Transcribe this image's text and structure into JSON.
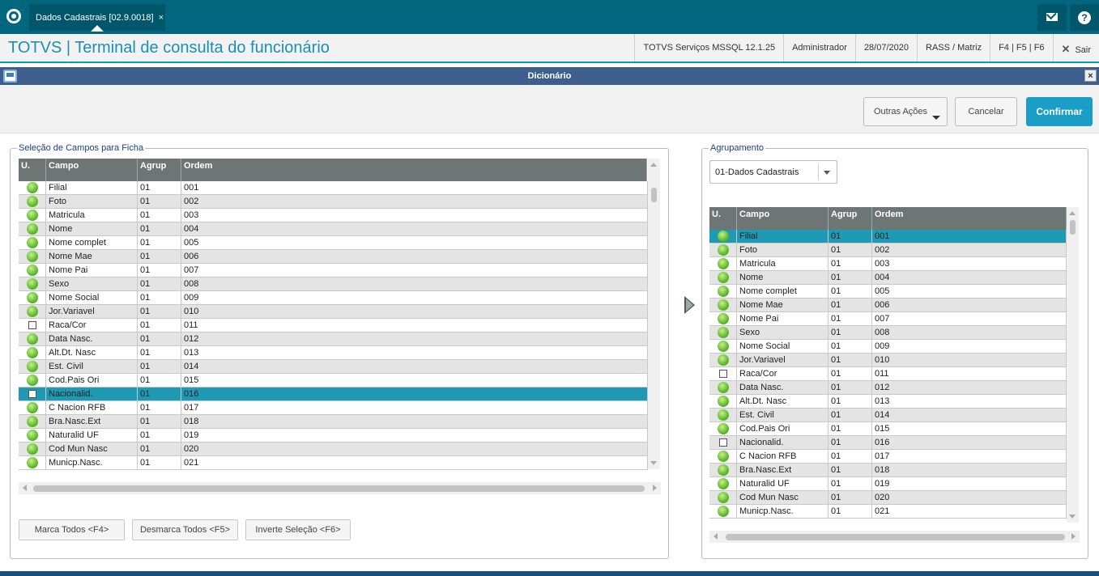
{
  "topbar": {
    "tab_label": "Dados Cadastrais [02.9.0018]",
    "tab_close": "×"
  },
  "header": {
    "title": "TOTVS | Terminal de consulta do funcionário",
    "server": "TOTVS Serviços MSSQL 12.1.25",
    "user": "Administrador",
    "date": "28/07/2020",
    "branch": "RASS / Matriz",
    "shortcuts": "F4 | F5 | F6",
    "exit_icon": "✕",
    "exit_label": "Sair"
  },
  "dialog": {
    "title": "Dicionário",
    "close": "×"
  },
  "actions": {
    "other": "Outras Ações",
    "cancel": "Cancelar",
    "confirm": "Confirmar"
  },
  "left_panel": {
    "legend": "Seleção de Campos para Ficha",
    "columns": [
      "U.",
      "Campo",
      "Agrup",
      "Ordem"
    ],
    "rows": [
      {
        "u": "dot",
        "campo": "Filial",
        "agrup": "01",
        "ordem": "001"
      },
      {
        "u": "dot",
        "campo": "Foto",
        "agrup": "01",
        "ordem": "002"
      },
      {
        "u": "dot",
        "campo": "Matricula",
        "agrup": "01",
        "ordem": "003"
      },
      {
        "u": "dot",
        "campo": "Nome",
        "agrup": "01",
        "ordem": "004"
      },
      {
        "u": "dot",
        "campo": "Nome complet",
        "agrup": "01",
        "ordem": "005"
      },
      {
        "u": "dot",
        "campo": "Nome Mae",
        "agrup": "01",
        "ordem": "006"
      },
      {
        "u": "dot",
        "campo": "Nome Pai",
        "agrup": "01",
        "ordem": "007"
      },
      {
        "u": "dot",
        "campo": "Sexo",
        "agrup": "01",
        "ordem": "008"
      },
      {
        "u": "dot",
        "campo": "Nome Social",
        "agrup": "01",
        "ordem": "009"
      },
      {
        "u": "dot",
        "campo": "Jor.Variavel",
        "agrup": "01",
        "ordem": "010"
      },
      {
        "u": "box",
        "campo": "Raca/Cor",
        "agrup": "01",
        "ordem": "011"
      },
      {
        "u": "dot",
        "campo": "Data Nasc.",
        "agrup": "01",
        "ordem": "012"
      },
      {
        "u": "dot",
        "campo": "Alt.Dt. Nasc",
        "agrup": "01",
        "ordem": "013"
      },
      {
        "u": "dot",
        "campo": "Est. Civil",
        "agrup": "01",
        "ordem": "014"
      },
      {
        "u": "dot",
        "campo": "Cod.Pais Ori",
        "agrup": "01",
        "ordem": "015"
      },
      {
        "u": "box",
        "campo": "Nacionalid.",
        "agrup": "01",
        "ordem": "016",
        "selected": true
      },
      {
        "u": "dot",
        "campo": "C Nacion RFB",
        "agrup": "01",
        "ordem": "017"
      },
      {
        "u": "dot",
        "campo": "Bra.Nasc.Ext",
        "agrup": "01",
        "ordem": "018"
      },
      {
        "u": "dot",
        "campo": "Naturalid UF",
        "agrup": "01",
        "ordem": "019"
      },
      {
        "u": "dot",
        "campo": "Cod Mun Nasc",
        "agrup": "01",
        "ordem": "020"
      },
      {
        "u": "dot",
        "campo": "Municp.Nasc.",
        "agrup": "01",
        "ordem": "021"
      }
    ],
    "buttons": {
      "mark_all": "Marca Todos <F4>",
      "unmark_all": "Desmarca Todos <F5>",
      "invert": "Inverte Seleção <F6>"
    }
  },
  "right_panel": {
    "legend": "Agrupamento",
    "group_select": "01-Dados Cadastrais",
    "columns": [
      "U.",
      "Campo",
      "Agrup",
      "Ordem"
    ],
    "rows": [
      {
        "u": "dot",
        "campo": "Filial",
        "agrup": "01",
        "ordem": "001",
        "selected": true
      },
      {
        "u": "dot",
        "campo": "Foto",
        "agrup": "01",
        "ordem": "002"
      },
      {
        "u": "dot",
        "campo": "Matricula",
        "agrup": "01",
        "ordem": "003"
      },
      {
        "u": "dot",
        "campo": "Nome",
        "agrup": "01",
        "ordem": "004"
      },
      {
        "u": "dot",
        "campo": "Nome complet",
        "agrup": "01",
        "ordem": "005"
      },
      {
        "u": "dot",
        "campo": "Nome Mae",
        "agrup": "01",
        "ordem": "006"
      },
      {
        "u": "dot",
        "campo": "Nome Pai",
        "agrup": "01",
        "ordem": "007"
      },
      {
        "u": "dot",
        "campo": "Sexo",
        "agrup": "01",
        "ordem": "008"
      },
      {
        "u": "dot",
        "campo": "Nome Social",
        "agrup": "01",
        "ordem": "009"
      },
      {
        "u": "dot",
        "campo": "Jor.Variavel",
        "agrup": "01",
        "ordem": "010"
      },
      {
        "u": "box",
        "campo": "Raca/Cor",
        "agrup": "01",
        "ordem": "011"
      },
      {
        "u": "dot",
        "campo": "Data Nasc.",
        "agrup": "01",
        "ordem": "012"
      },
      {
        "u": "dot",
        "campo": "Alt.Dt. Nasc",
        "agrup": "01",
        "ordem": "013"
      },
      {
        "u": "dot",
        "campo": "Est. Civil",
        "agrup": "01",
        "ordem": "014"
      },
      {
        "u": "dot",
        "campo": "Cod.Pais Ori",
        "agrup": "01",
        "ordem": "015"
      },
      {
        "u": "box",
        "campo": "Nacionalid.",
        "agrup": "01",
        "ordem": "016"
      },
      {
        "u": "dot",
        "campo": "C Nacion RFB",
        "agrup": "01",
        "ordem": "017"
      },
      {
        "u": "dot",
        "campo": "Bra.Nasc.Ext",
        "agrup": "01",
        "ordem": "018"
      },
      {
        "u": "dot",
        "campo": "Naturalid UF",
        "agrup": "01",
        "ordem": "019"
      },
      {
        "u": "dot",
        "campo": "Cod Mun Nasc",
        "agrup": "01",
        "ordem": "020"
      },
      {
        "u": "dot",
        "campo": "Municp.Nasc.",
        "agrup": "01",
        "ordem": "021"
      }
    ]
  },
  "colors": {
    "topbar": "#00677f",
    "accent": "#1a9dc7",
    "selected_row": "#1e9ab5",
    "dialog_title": "#3e5f8e",
    "grid_header": "#6e7575"
  }
}
